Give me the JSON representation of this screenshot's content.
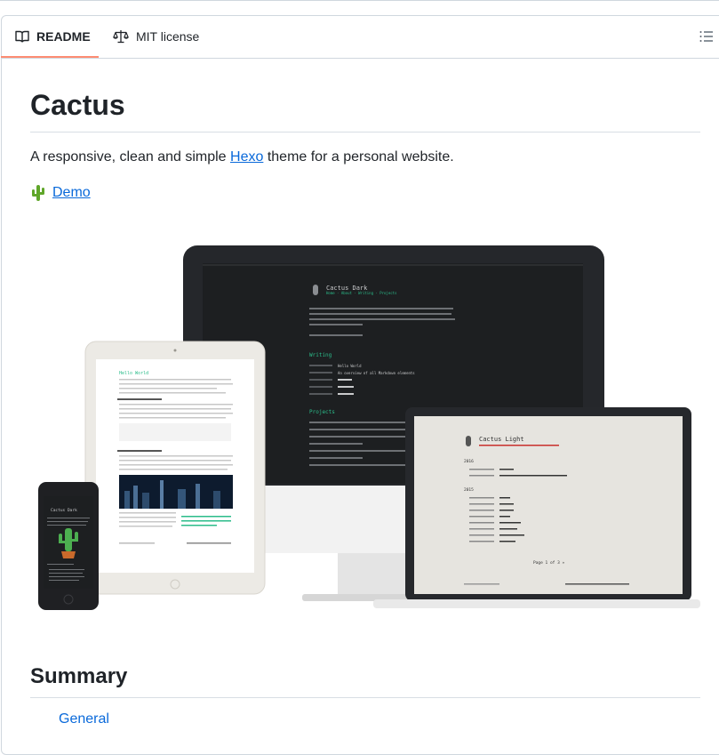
{
  "tabs": {
    "readme": "README",
    "license": "MIT license"
  },
  "readme": {
    "title": "Cactus",
    "desc_before": "A responsive, clean and simple ",
    "desc_link": "Hexo",
    "desc_after": " theme for a personal website.",
    "demo_label": "Demo",
    "summary_heading": "Summary",
    "summary_first_item": "General"
  },
  "mockup": {
    "dark_title": "Cactus Dark",
    "light_title": "Cactus Light",
    "dark_nav": [
      "Home",
      "About",
      "Writing",
      "Projects"
    ],
    "writing_label": "Writing",
    "projects_label": "Projects",
    "post_hello": "Hello World",
    "post_overview": "An overview of all Markdown elements",
    "year_2016": "2016",
    "year_2015": "2015",
    "pager": "Page 1 of 3  »",
    "ipad_post_title": "Hello World",
    "phone_title": "Cactus Dark"
  },
  "colors": {
    "accent": "#0969da",
    "tab_underline": "#fd8c73",
    "dark_accent": "#2bbc8a",
    "light_accent": "#c9302c"
  }
}
